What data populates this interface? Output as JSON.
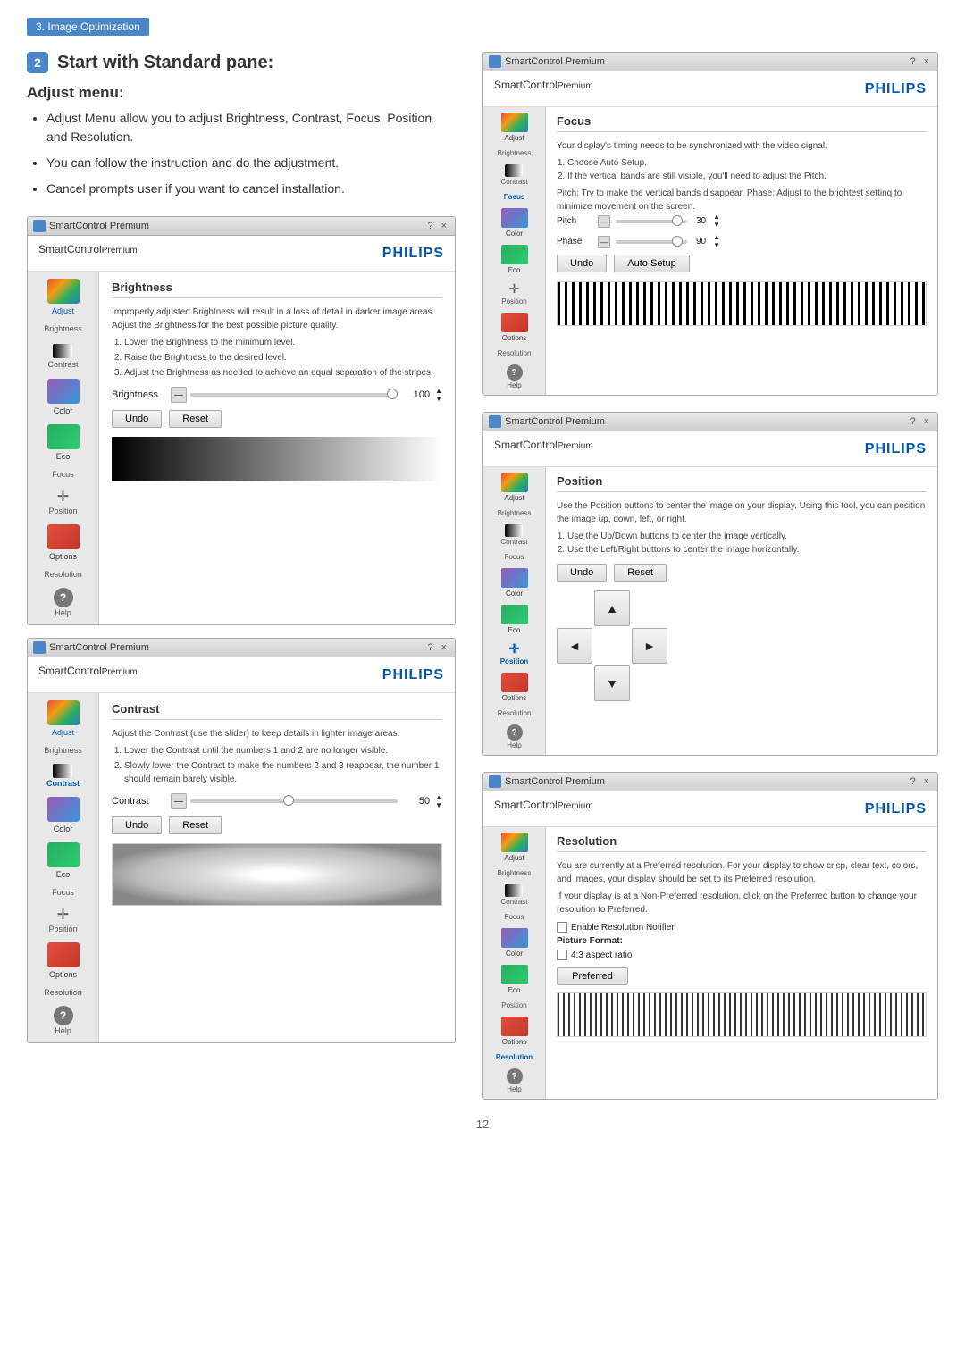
{
  "badge": {
    "number": "3.",
    "label": "Image Optimization"
  },
  "section1": {
    "number": "2",
    "title": "Start with Standard pane:"
  },
  "adjust_menu": {
    "title": "Adjust menu:",
    "items": [
      "Adjust Menu allow you to adjust Brightness, Contrast, Focus, Position and Resolution.",
      "You can follow the instruction and do the adjustment.",
      "Cancel prompts user if you want to cancel installation."
    ]
  },
  "smartcontrol_windows": [
    {
      "id": "brightness",
      "titlebar": "SmartControl Premium",
      "logo": "SmartControl",
      "logo_super": "Premium",
      "brand": "PHILIPS",
      "section": "Brightness",
      "desc": "Improperly adjusted Brightness will result in a loss of detail in darker image areas. Adjust the Brightness for the best possible picture quality.",
      "desc_items": [
        "Lower the Brightness to the minimum level.",
        "Raise the Brightness to the desired level.",
        "Adjust the Brightness as needed to achieve an equal separation of the stripes."
      ],
      "slider_label": "Brightness",
      "slider_value": "100",
      "buttons": [
        "Undo",
        "Reset"
      ],
      "sidebar_items": [
        "Adjust",
        "Color",
        "Eco",
        "Options",
        "Help"
      ],
      "sidebar_sub_items": [
        "Brightness",
        "Contrast",
        "Focus",
        "Position",
        "Resolution"
      ]
    },
    {
      "id": "contrast",
      "titlebar": "SmartControl Premium",
      "logo": "SmartControl",
      "logo_super": "Premium",
      "brand": "PHILIPS",
      "section": "Contrast",
      "desc": "Adjust the Contrast (use the slider) to keep details in lighter image areas.",
      "desc_items": [
        "Lower the Contrast until the numbers 1 and 2 are no longer visible.",
        "Slowly lower the Contrast to make the numbers 2 and 3 reappear, the number 1 should remain barely visible."
      ],
      "slider_label": "Contrast",
      "slider_value": "50",
      "buttons": [
        "Undo",
        "Reset"
      ],
      "sidebar_items": [
        "Adjust",
        "Color",
        "Eco",
        "Options",
        "Help"
      ],
      "sidebar_sub_items": [
        "Brightness",
        "Contrast",
        "Focus",
        "Position",
        "Resolution"
      ]
    }
  ],
  "right_windows": [
    {
      "id": "focus",
      "titlebar": "SmartControl Premium",
      "logo": "SmartControl",
      "logo_super": "Premium",
      "brand": "PHILIPS",
      "section": "Focus",
      "desc": "Your display's timing needs to be synchronized with the video signal.",
      "desc_items": [
        "Choose Auto Setup.",
        "If the vertical bands are still visible, you'll need to adjust the Pitch."
      ],
      "extra_desc": "Pitch: Try to make the vertical bands disappear. Phase: Adjust to the brightest setting to minimize movement on the screen.",
      "pitch_label": "Pitch",
      "pitch_value": "30",
      "phase_label": "Phase",
      "phase_value": "90",
      "buttons": [
        "Undo",
        "Auto Setup"
      ],
      "sidebar_items": [
        "Adjust",
        "Color",
        "Eco",
        "Options",
        "Help"
      ],
      "sidebar_sub_items": [
        "Brightness",
        "Contrast",
        "Focus",
        "Position",
        "Resolution"
      ]
    },
    {
      "id": "position",
      "titlebar": "SmartControl Premium",
      "logo": "SmartControl",
      "logo_super": "Premium",
      "brand": "PHILIPS",
      "section": "Position",
      "desc": "Use the Position buttons to center the image on your display. Using this tool, you can position the image up, down, left, or right.",
      "desc_items": [
        "Use the Up/Down buttons to center the image vertically.",
        "Use the Left/Right buttons to center the image horizontally."
      ],
      "buttons": [
        "Undo",
        "Reset"
      ],
      "sidebar_items": [
        "Adjust",
        "Color",
        "Eco",
        "Options",
        "Help"
      ],
      "sidebar_sub_items": [
        "Brightness",
        "Contrast",
        "Focus",
        "Position",
        "Resolution"
      ]
    },
    {
      "id": "resolution",
      "titlebar": "SmartControl Premium",
      "logo": "SmartControl",
      "logo_super": "Premium",
      "brand": "PHILIPS",
      "section": "Resolution",
      "desc": "You are currently at a Preferred resolution. For your display to show crisp, clear text, colors, and images, your display should be set to its Preferred resolution.",
      "desc2": "If your display is at a Non-Preferred resolution, click on the Preferred button to change your resolution to Preferred.",
      "checkbox1": "Enable Resolution Notifier",
      "picture_format_label": "Picture Format:",
      "checkbox2": "4:3 aspect ratio",
      "buttons": [
        "Preferred"
      ],
      "sidebar_items": [
        "Adjust",
        "Color",
        "Eco",
        "Options",
        "Help"
      ],
      "sidebar_sub_items": [
        "Brightness",
        "Contrast",
        "Focus",
        "Position",
        "Resolution"
      ]
    }
  ],
  "page_number": "12"
}
